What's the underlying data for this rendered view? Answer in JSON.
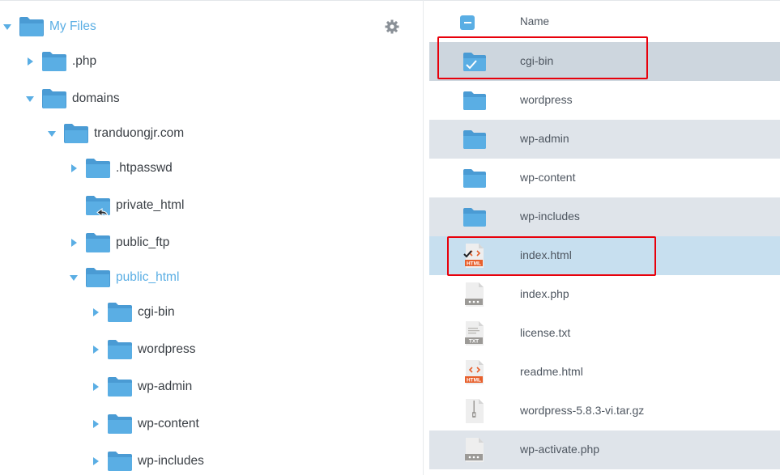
{
  "tree": {
    "root": {
      "label": "My Files"
    },
    "nodes": [
      {
        "label": ".php"
      },
      {
        "label": "domains"
      },
      {
        "label": "tranduongjr.com"
      },
      {
        "label": ".htpasswd"
      },
      {
        "label": "private_html"
      },
      {
        "label": "public_ftp"
      },
      {
        "label": "public_html"
      },
      {
        "label": "cgi-bin"
      },
      {
        "label": "wordpress"
      },
      {
        "label": "wp-admin"
      },
      {
        "label": "wp-content"
      },
      {
        "label": "wp-includes"
      }
    ],
    "settings_icon": "gear-icon"
  },
  "file_list": {
    "header": {
      "name_label": "Name"
    },
    "rows": [
      {
        "name": "cgi-bin",
        "type": "folder-checked-icon"
      },
      {
        "name": "wordpress",
        "type": "folder-icon"
      },
      {
        "name": "wp-admin",
        "type": "folder-icon"
      },
      {
        "name": "wp-content",
        "type": "folder-icon"
      },
      {
        "name": "wp-includes",
        "type": "folder-icon"
      },
      {
        "name": "index.html",
        "type": "html-file-checked-icon",
        "badge": "HTML"
      },
      {
        "name": "index.php",
        "type": "php-file-icon"
      },
      {
        "name": "license.txt",
        "type": "txt-file-icon",
        "badge": "TXT"
      },
      {
        "name": "readme.html",
        "type": "html-file-icon",
        "badge": "HTML"
      },
      {
        "name": "wordpress-5.8.3-vi.tar.gz",
        "type": "archive-file-icon"
      },
      {
        "name": "wp-activate.php",
        "type": "php-file-icon"
      }
    ]
  },
  "colors": {
    "accent": "#5aaee4",
    "folder": "#5aaee4",
    "highlight_border": "#e8000b",
    "row_alt": "#dfe4ea",
    "row_selected": "#c7dfef",
    "html_badge": "#e8602c"
  }
}
